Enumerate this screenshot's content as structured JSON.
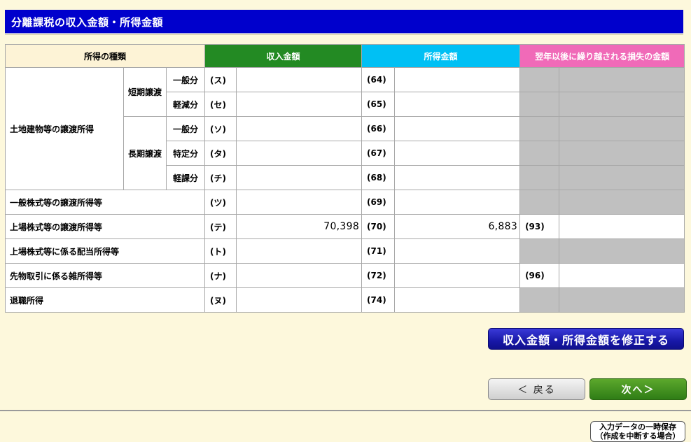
{
  "page": {
    "title": "分離課税の収入金額・所得金額"
  },
  "table": {
    "headers": {
      "kind": "所得の種類",
      "income": "収入金額",
      "amount": "所得金額",
      "loss": "翌年以後に繰り越される損失の金額"
    },
    "land_group": "土地建物等の譲渡所得",
    "short_term": "短期譲渡",
    "long_term": "長期譲渡",
    "rows": [
      {
        "sub": "一般分",
        "code": "(ス)",
        "code2": "(64)",
        "income": "",
        "amount": ""
      },
      {
        "sub": "軽減分",
        "code": "(セ)",
        "code2": "(65)",
        "income": "",
        "amount": ""
      },
      {
        "sub": "一般分",
        "code": "(ソ)",
        "code2": "(66)",
        "income": "",
        "amount": ""
      },
      {
        "sub": "特定分",
        "code": "(タ)",
        "code2": "(67)",
        "income": "",
        "amount": ""
      },
      {
        "sub": "軽課分",
        "code": "(チ)",
        "code2": "(68)",
        "income": "",
        "amount": ""
      },
      {
        "label": "一般株式等の譲渡所得等",
        "code": "(ツ)",
        "code2": "(69)",
        "income": "",
        "amount": ""
      },
      {
        "label": "上場株式等の譲渡所得等",
        "code": "(テ)",
        "code2": "(70)",
        "income": "70,398",
        "amount": "6,883",
        "code3": "(93)",
        "loss": ""
      },
      {
        "label": "上場株式等に係る配当所得等",
        "code": "(ト)",
        "code2": "(71)",
        "income": "",
        "amount": ""
      },
      {
        "label": "先物取引に係る雑所得等",
        "code": "(ナ)",
        "code2": "(72)",
        "income": "",
        "amount": "",
        "code3": "(96)",
        "loss": ""
      },
      {
        "label": "退職所得",
        "code": "(ヌ)",
        "code2": "(74)",
        "income": "",
        "amount": ""
      }
    ]
  },
  "buttons": {
    "edit": "収入金額・所得金額を修正する",
    "back": "＜ 戻る",
    "next": "次へ＞",
    "save_line1": "入力データの一時保存",
    "save_line2": "（作成を中断する場合）"
  }
}
